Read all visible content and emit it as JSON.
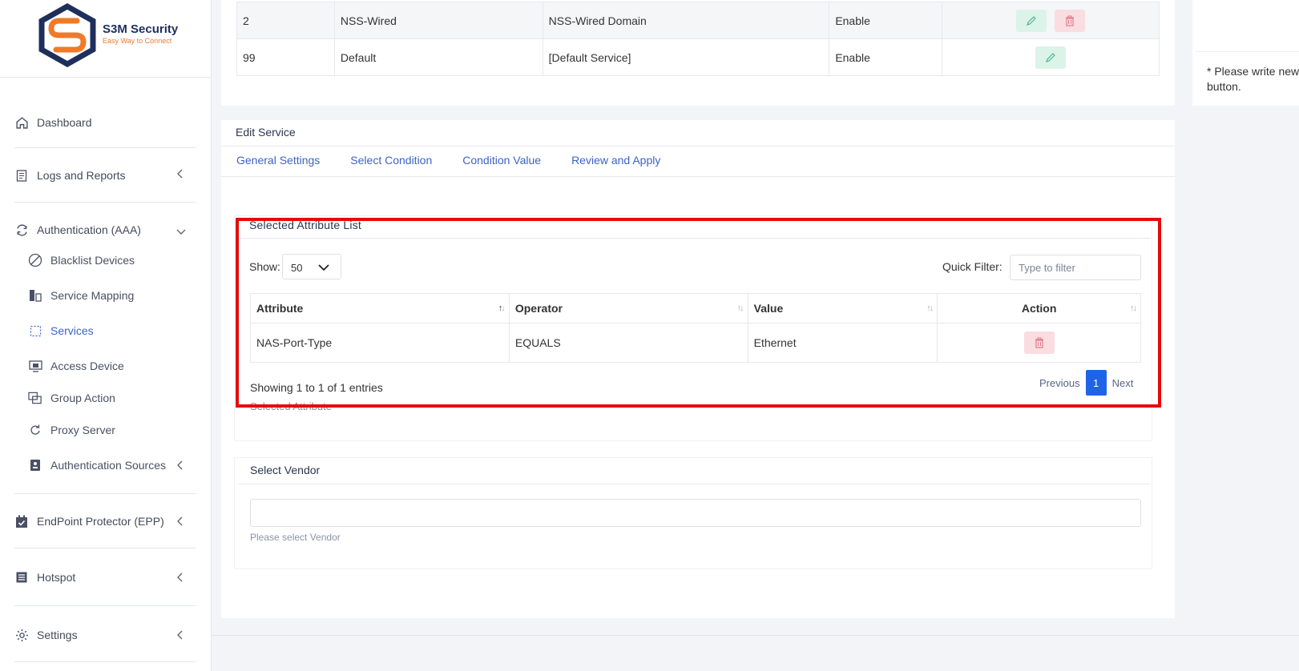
{
  "brand": {
    "title": "S3M Security",
    "tagline": "Easy Way to Connect",
    "colors": {
      "primary": "#1f2f5c",
      "accent": "#f07a28",
      "link": "#3d63c8",
      "highlight": "#e80909"
    }
  },
  "sidebar": {
    "items": [
      {
        "label": "Dashboard",
        "icon": "home-icon"
      },
      {
        "label": "Logs and Reports",
        "icon": "report-icon"
      },
      {
        "label": "Authentication (AAA)",
        "icon": "sync-icon"
      },
      {
        "label": "EndPoint Protector (EPP)",
        "icon": "calendar-check-icon"
      },
      {
        "label": "Hotspot",
        "icon": "list-icon"
      },
      {
        "label": "Settings",
        "icon": "gear-icon"
      }
    ],
    "aaa_sub": [
      {
        "label": "Blacklist Devices",
        "icon": "block-icon"
      },
      {
        "label": "Service Mapping",
        "icon": "mapping-icon"
      },
      {
        "label": "Services",
        "icon": "services-icon"
      },
      {
        "label": "Access Device",
        "icon": "monitor-icon"
      },
      {
        "label": "Group Action",
        "icon": "group-icon"
      },
      {
        "label": "Proxy Server",
        "icon": "redo-icon"
      },
      {
        "label": "Authentication Sources",
        "icon": "id-card-icon"
      }
    ]
  },
  "services_table": {
    "rows": [
      {
        "id": "2",
        "name": "NSS-Wired",
        "description": "NSS-Wired Domain",
        "status": "Enable"
      },
      {
        "id": "99",
        "name": "Default",
        "description": "[Default Service]",
        "status": "Enable"
      }
    ]
  },
  "edit_service": {
    "title": "Edit Service",
    "tabs": [
      "General Settings",
      "Select Condition",
      "Condition Value",
      "Review and Apply"
    ],
    "active_tab": "Select Condition"
  },
  "attribute_list": {
    "title": "Selected Attribute List",
    "show_label": "Show:",
    "show_value": "50",
    "quick_filter_label": "Quick Filter:",
    "quick_filter_placeholder": "Type to filter",
    "columns": [
      "Attribute",
      "Operator",
      "Value",
      "Action"
    ],
    "rows": [
      {
        "attribute": "NAS-Port-Type",
        "operator": "EQUALS",
        "value": "Ethernet"
      }
    ],
    "showing": "Showing 1 to 1 of 1 entries",
    "prev": "Previous",
    "page": "1",
    "next": "Next",
    "hidden_label": "Selected Attribute"
  },
  "vendor": {
    "title": "Select Vendor",
    "help": "Please select Vendor"
  },
  "right_panel": {
    "note_line1": "* Please write new",
    "note_line2": "button."
  }
}
